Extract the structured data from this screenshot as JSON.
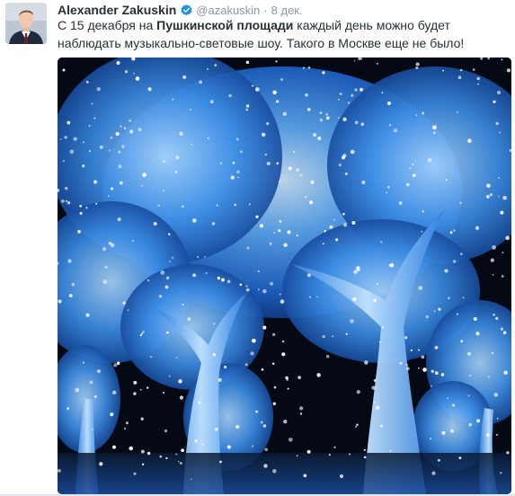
{
  "tweet": {
    "author_name": "Alexander Zakuskin",
    "handle": "@azakuskin",
    "separator": "·",
    "time": "8 дек.",
    "text_before": "С 15 декабря на ",
    "text_bold": "Пушкинской площади",
    "text_after": " каждый день можно будет наблюдать музыкально-световые шоу. Такого в Москве еще не было!"
  },
  "icons": {
    "verified": "verified-badge-icon",
    "avatar": "profile-photo"
  },
  "colors": {
    "verified_blue": "#1b95e0",
    "text": "#292f33",
    "muted": "#8899a6",
    "tree_glow": "#6fb7ff"
  }
}
